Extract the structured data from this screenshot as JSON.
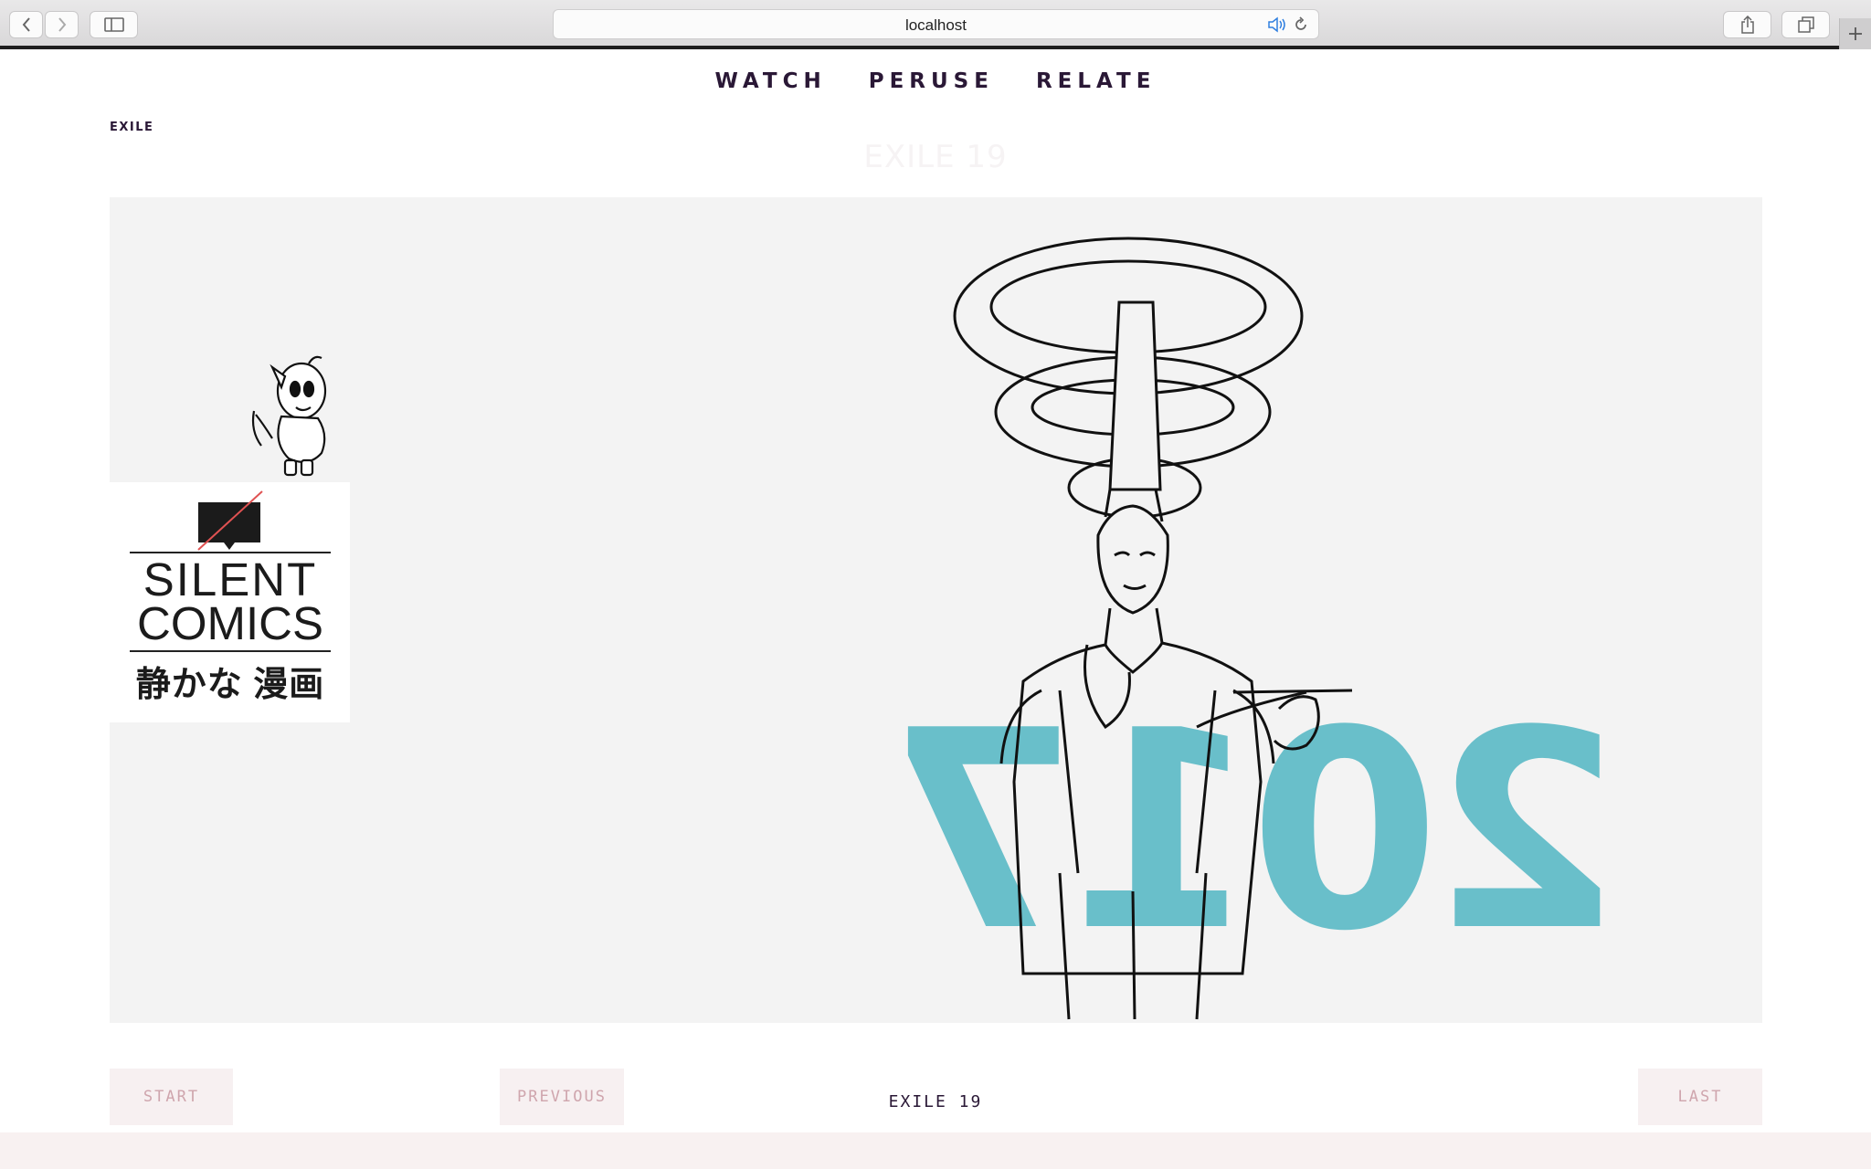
{
  "browser": {
    "url": "localhost",
    "icons": {
      "back": "chevron-left-icon",
      "forward": "chevron-right-icon",
      "sidebar": "sidebar-icon",
      "audio": "speaker-icon",
      "reload": "reload-icon",
      "share": "share-icon",
      "tabs": "tabs-icon",
      "new_tab": "plus-icon"
    }
  },
  "nav": {
    "items": [
      "WATCH",
      "PERUSE",
      "RELATE"
    ]
  },
  "breadcrumb": "EXILE",
  "title": "EXILE 19",
  "panel": {
    "logo": {
      "line1": "SILENT",
      "line2": "COMICS",
      "line3": "静かな 漫画"
    },
    "year": "2017"
  },
  "pager": {
    "start": "START",
    "previous": "PREVIOUS",
    "current": "EXILE 19",
    "last": "LAST"
  },
  "colors": {
    "accent_teal": "#69bfca",
    "nav_text": "#2a1836",
    "button_bg": "#f7f0f1",
    "button_text": "#cfa5ad"
  }
}
